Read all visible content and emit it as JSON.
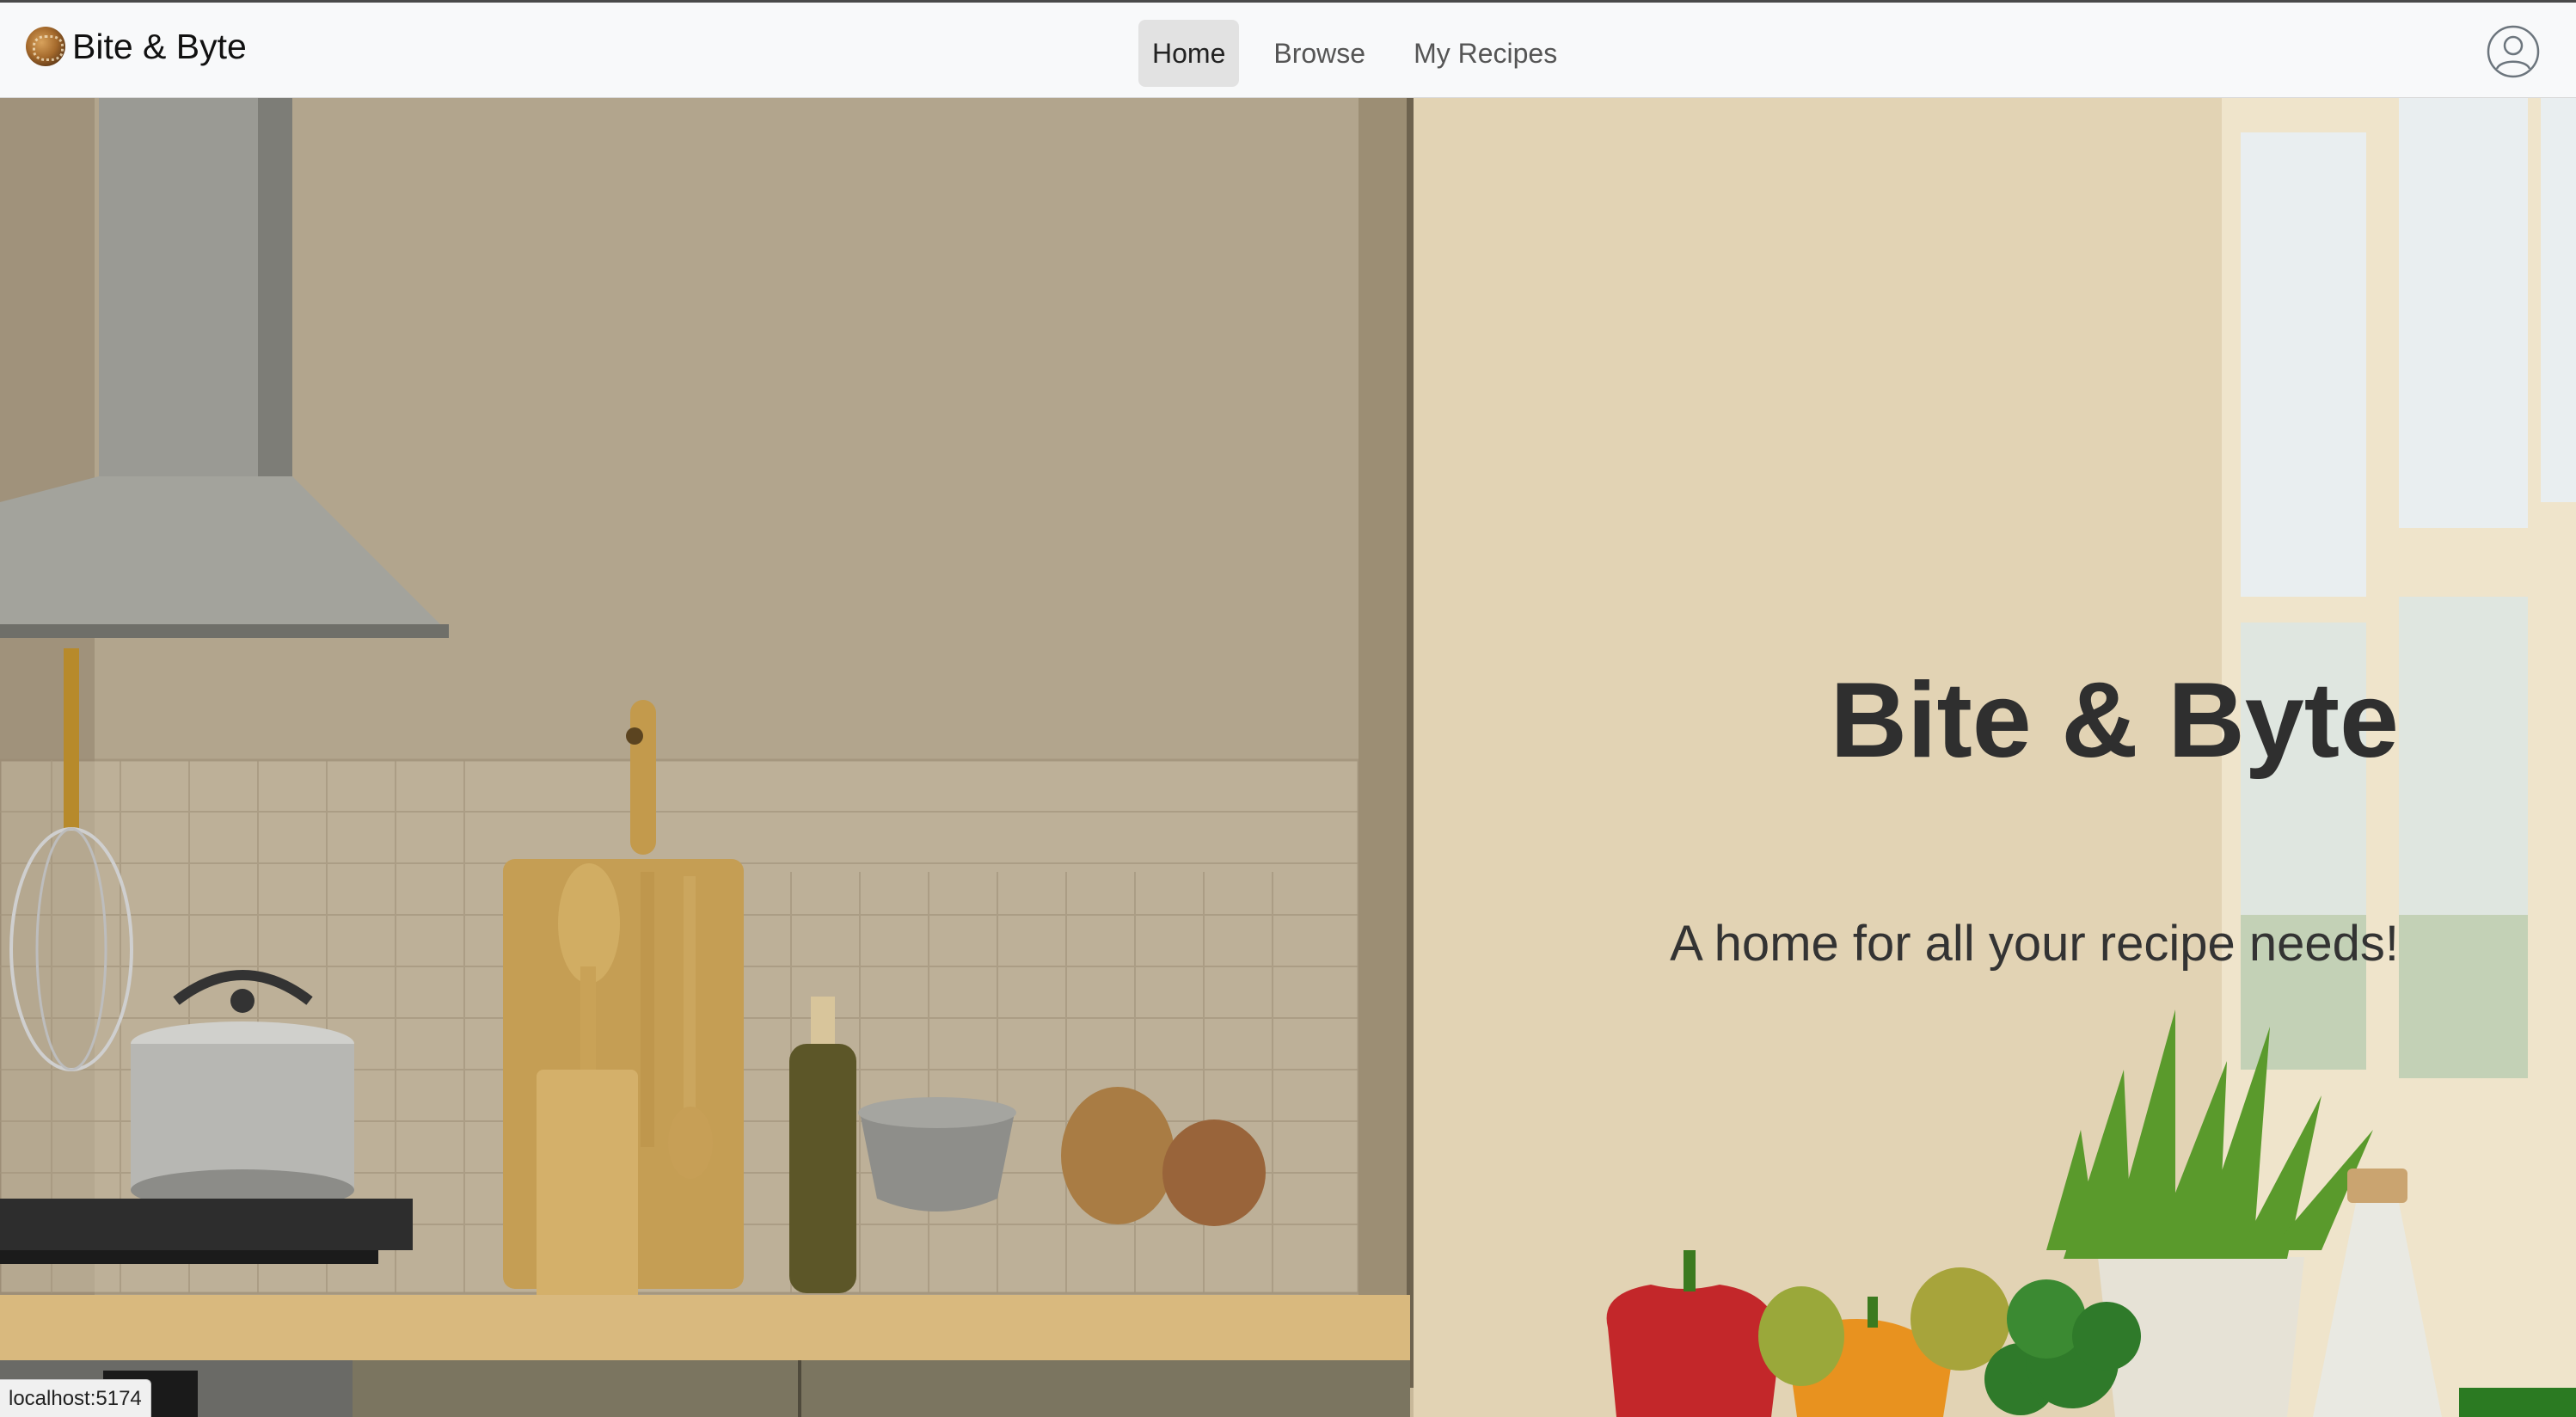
{
  "brand": {
    "name": "Bite & Byte",
    "logo_icon": "pie-logo-icon"
  },
  "nav": {
    "links": [
      {
        "label": "Home",
        "active": true
      },
      {
        "label": "Browse",
        "active": false
      },
      {
        "label": "My Recipes",
        "active": false
      }
    ],
    "user_icon": "user-circle-icon"
  },
  "hero": {
    "title": "Bite & Byte",
    "subtitle": "A home for all your recipe needs!",
    "background": "kitchen-scene-image"
  },
  "status_bar": {
    "url": "localhost:5174"
  },
  "colors": {
    "navbar_bg": "#f8f9fa",
    "active_link_bg": "#e2e2e2",
    "hero_text": "#2f2f2f"
  }
}
